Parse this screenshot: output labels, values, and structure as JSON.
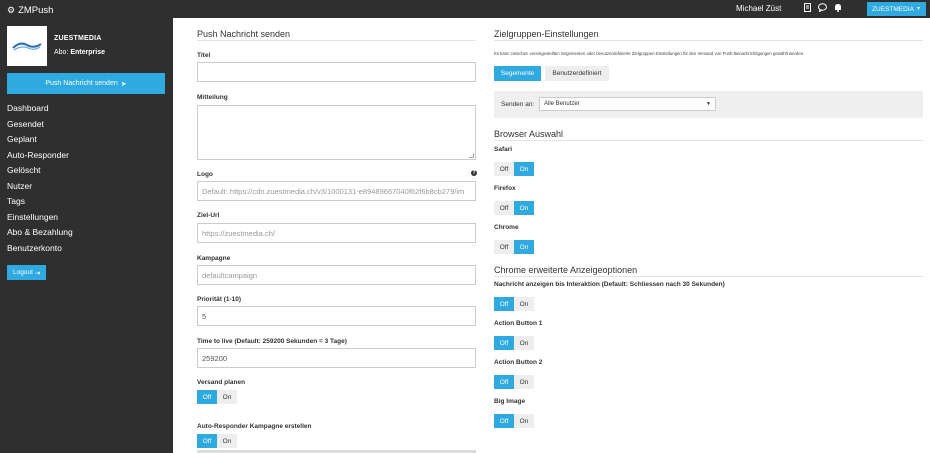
{
  "app": {
    "brand": "ZMPush"
  },
  "profile": {
    "name": "ZUESTMEDIA",
    "abo_prefix": "Abo:",
    "abo_plan": "Enterprise"
  },
  "sidebar": {
    "push_button": "Push Nachricht senden",
    "items": [
      "Dashboard",
      "Gesendet",
      "Geplant",
      "Auto-Responder",
      "Gelöscht",
      "Nutzer",
      "Tags",
      "Einstellungen",
      "Abo & Bezahlung",
      "Benutzerkonto"
    ],
    "logout": "Logout"
  },
  "topbar": {
    "user": "Michael Züst",
    "account": "ZUESTMEDIA"
  },
  "form": {
    "title": "Push Nachricht senden",
    "titel_label": "Titel",
    "mitteilung_label": "Mitteilung",
    "logo_label": "Logo",
    "logo_placeholder": "Default: https://cdn.zuestmedia.ch/v3/1000131-e89489667040f62f6b8cb279/im",
    "zielurl_label": "Ziel-Url",
    "zielurl_placeholder": "https://zuestmedia.ch/",
    "kampagne_label": "Kampagne",
    "kampagne_placeholder": "defaultcampaign",
    "prioritaet_label": "Priorität (1-10)",
    "prioritaet_value": "5",
    "ttl_label": "Time to live (Default: 259200 Sekunden = 3 Tage)",
    "ttl_value": "259200",
    "versand_label": "Versand planen",
    "autoresponder_label": "Auto-Responder Kampagne erstellen",
    "off": "Off",
    "on": "On"
  },
  "target": {
    "title": "Zielgruppen-Einstellungen",
    "info": "Es kann zwischen voreingestellten Segementen oder benutzerdefinierte Zielgruppen-Einstellungen für den Versand von Push-Benachrichtigungen gewählt werden.",
    "seg_button": "Segemente",
    "custom_button": "Benutzerdefiniert",
    "senden_label": "Senden an:",
    "senden_value": "Alle Benutzer"
  },
  "browser": {
    "title": "Browser Auswahl",
    "safari": "Safari",
    "firefox": "Firefox",
    "chrome": "Chrome"
  },
  "chrome_opts": {
    "title": "Chrome erweiterte Anzeigeoptionen",
    "interaction": "Nachricht anzeigen bis Interaktion (Default: Schliessen nach 30 Sekunden)",
    "action1": "Action Button 1",
    "action2": "Action Button 2",
    "big_image": "Big Image"
  },
  "colors": {
    "accent": "#2eaae1",
    "sidebar": "#2f2f2f"
  },
  "icons": [
    "gear-icon",
    "send-icon",
    "logout-icon",
    "document-icon",
    "chat-icon",
    "bell-icon",
    "caret-down-icon",
    "help-icon"
  ]
}
